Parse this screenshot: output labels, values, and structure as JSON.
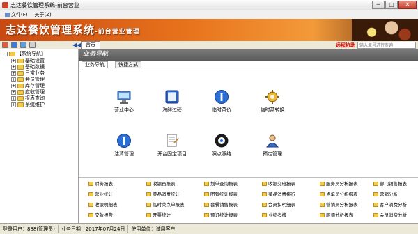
{
  "window": {
    "title": "志达餐饮管理系统-前台营业",
    "btn_min": "─",
    "btn_max": "□",
    "btn_close": "✕"
  },
  "menu": [
    {
      "label": "文件(F)"
    },
    {
      "label": "关于(Z)"
    }
  ],
  "banner": {
    "title": "志达餐饮管理系统",
    "subtitle": "-前台营业管理"
  },
  "toolbar": {
    "home_tab": "首页",
    "remote_help": "远程协助",
    "search_placeholder": "输入单号进行查询",
    "collapse_arrow": "◀◀"
  },
  "tree": {
    "root": "【系统导航】",
    "items": [
      {
        "label": "基础设置"
      },
      {
        "label": "基础数据"
      },
      {
        "label": "日常业务"
      },
      {
        "label": "会员管理"
      },
      {
        "label": "库存管理"
      },
      {
        "label": "应收管理"
      },
      {
        "label": "报表查询"
      },
      {
        "label": "系统维护"
      }
    ]
  },
  "main": {
    "header": "业务导航",
    "tabs": [
      {
        "label": "业务导航"
      },
      {
        "label": "快捷方式"
      }
    ],
    "functions": [
      {
        "label": "营业中心",
        "icon": "monitor-icon"
      },
      {
        "label": "海鲜过磅",
        "icon": "window-icon"
      },
      {
        "label": "临时菜价",
        "icon": "info-icon"
      },
      {
        "label": "临时菜转换",
        "icon": "gear-icon"
      },
      {
        "label": "沽清管理",
        "icon": "info-icon"
      },
      {
        "label": "开台固定项目",
        "icon": "document-icon"
      },
      {
        "label": "照点照结",
        "icon": "disc-icon"
      },
      {
        "label": "预定管理",
        "icon": "user-icon"
      }
    ],
    "reports": [
      [
        "财务报表",
        "收银员报表",
        "划单查询报表",
        "收银交班报表",
        "服务员分析报表",
        "部门销售报表"
      ],
      [
        "营业统计",
        "菜品消费统计",
        "团餐统计报表",
        "菜品消费排行",
        "点单员分析报表",
        "营销分析"
      ],
      [
        "收银明细表",
        "临时菜点单报表",
        "套餐销售报表",
        "会员扣明细表",
        "营销员分析报表",
        "客户消费分析"
      ],
      [
        "交款报告",
        "开票统计",
        "预订统计报表",
        "业绩考核",
        "厨师分析报表",
        "会员消费分析"
      ]
    ]
  },
  "status": {
    "login_user": "登录用户：888(管理员)",
    "business_date": "业务日期：2017年07月24日",
    "unit": "使用单位：试用客户"
  }
}
